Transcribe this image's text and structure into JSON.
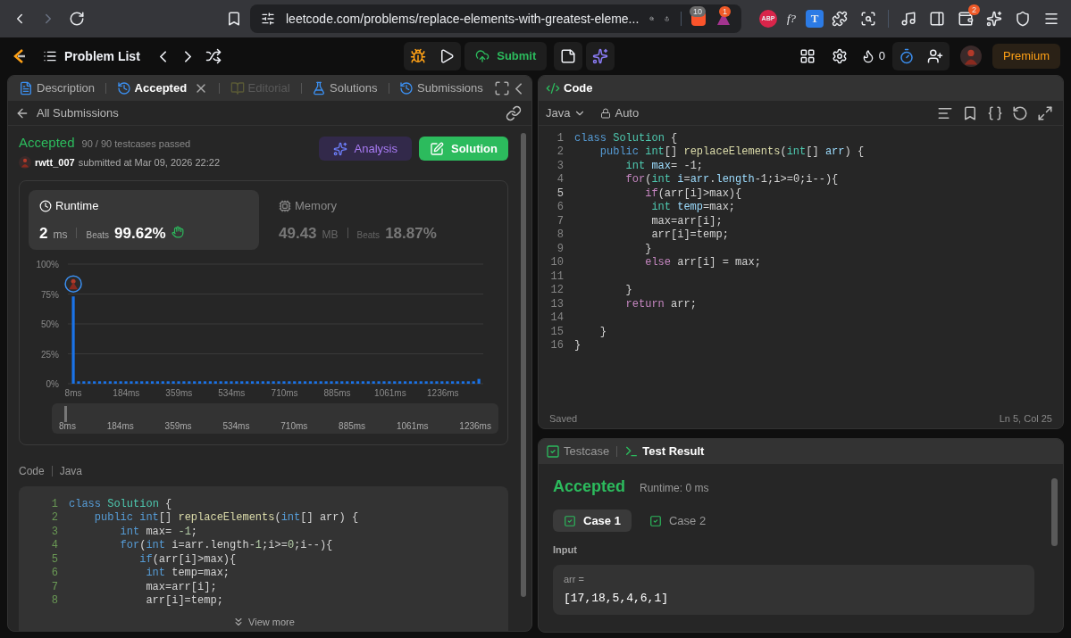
{
  "browser": {
    "url": "leetcode.com/problems/replace-elements-with-greatest-eleme...",
    "brave_badge": "10",
    "alert_badge": "1",
    "abp_label": "ABP",
    "font_label": "f?",
    "t_label": "T",
    "wallet_badge": "2"
  },
  "nav": {
    "problem_list": "Problem List",
    "submit": "Submit",
    "streak": "0",
    "premium": "Premium"
  },
  "left_panel": {
    "tabs": [
      {
        "label": "Description",
        "kind": "doc",
        "selected": false,
        "disabled": false
      },
      {
        "label": "Accepted",
        "kind": "history",
        "selected": true,
        "disabled": false
      },
      {
        "label": "Editorial",
        "kind": "book",
        "selected": false,
        "disabled": true
      },
      {
        "label": "Solutions",
        "kind": "flask",
        "selected": false,
        "disabled": false
      },
      {
        "label": "Submissions",
        "kind": "history",
        "selected": false,
        "disabled": false
      }
    ],
    "back_link": "All Submissions",
    "result": {
      "status": "Accepted",
      "testcases": "90 / 90 testcases passed",
      "user": "rwtt_007",
      "submitted": "submitted at Mar 09, 2026 22:22"
    },
    "analysis_button": "Analysis",
    "solution_button": "Solution",
    "stats": [
      {
        "kind": "runtime",
        "label": "Runtime",
        "value": "2",
        "unit": "ms",
        "beats_label": "Beats",
        "beats": "99.62%",
        "selected": true
      },
      {
        "kind": "memory",
        "label": "Memory",
        "value": "49.43",
        "unit": "MB",
        "beats_label": "Beats",
        "beats": "18.87%",
        "selected": false
      }
    ],
    "chart_data": {
      "type": "bar",
      "grid": true,
      "ylim": [
        0,
        100
      ],
      "xlim": [
        -10,
        1370
      ],
      "yticks": [
        {
          "value": 0,
          "label": "0%"
        },
        {
          "value": 25,
          "label": "25%"
        },
        {
          "value": 50,
          "label": "50%"
        },
        {
          "value": 75,
          "label": "75%"
        },
        {
          "value": 100,
          "label": "100%"
        }
      ],
      "xticks": [
        {
          "value": 8,
          "label": "8ms"
        },
        {
          "value": 184,
          "label": "184ms"
        },
        {
          "value": 359,
          "label": "359ms"
        },
        {
          "value": 534,
          "label": "534ms"
        },
        {
          "value": 710,
          "label": "710ms"
        },
        {
          "value": 885,
          "label": "885ms"
        },
        {
          "value": 1061,
          "label": "1061ms"
        },
        {
          "value": 1236,
          "label": "1236ms"
        }
      ],
      "x": [
        8,
        25.5,
        43,
        60.5,
        78,
        95.5,
        113,
        130.5,
        148,
        165.5,
        183,
        200.5,
        218,
        235.5,
        253,
        270.5,
        288,
        305.5,
        323,
        340.5,
        358,
        375.5,
        393,
        410.5,
        428,
        445.5,
        463,
        480.5,
        498,
        515.5,
        533,
        550.5,
        568,
        585.5,
        603,
        620.5,
        638,
        655.5,
        673,
        690.5,
        708,
        725.5,
        743,
        760.5,
        778,
        795.5,
        813,
        830.5,
        848,
        865.5,
        883,
        900.5,
        918,
        935.5,
        953,
        970.5,
        988,
        1005.5,
        1023,
        1040.5,
        1058,
        1075.5,
        1093,
        1110.5,
        1128,
        1145.5,
        1163,
        1180.5,
        1198,
        1215.5,
        1233,
        1250.5,
        1268,
        1285.5,
        1303,
        1320.5,
        1338,
        1355.5
      ],
      "series": [
        {
          "color": "#1a73e8",
          "values": [
            73,
            2,
            2,
            2,
            2,
            2,
            2,
            2,
            2,
            2,
            2,
            2,
            2,
            2,
            2,
            2,
            2,
            2,
            2,
            2,
            2,
            2,
            2,
            2,
            2,
            2,
            2,
            2,
            2,
            2,
            2,
            2,
            2,
            2,
            2,
            2,
            2,
            2,
            2,
            2,
            2,
            2,
            2,
            2,
            2,
            2,
            2,
            2,
            2,
            2,
            2,
            2,
            2,
            2,
            2,
            2,
            2,
            2,
            2,
            2,
            2,
            2,
            2,
            2,
            2,
            2,
            2,
            2,
            2,
            2,
            2,
            2,
            2,
            2,
            2,
            2,
            2,
            4
          ]
        }
      ]
    },
    "range_labels": [
      "8ms",
      "184ms",
      "359ms",
      "534ms",
      "710ms",
      "885ms",
      "1061ms",
      "1236ms"
    ],
    "code_label": "Code",
    "code_language": "Java",
    "code_lines": [
      {
        "n": "1",
        "tokens": [
          {
            "t": "class ",
            "kind": "kw"
          },
          {
            "t": "Solution",
            "kind": "type"
          },
          {
            "t": " {",
            "kind": "plain"
          }
        ]
      },
      {
        "n": "2",
        "tokens": [
          {
            "t": "    public ",
            "kind": "kw"
          },
          {
            "t": "int",
            "kind": "kw"
          },
          {
            "t": "[] ",
            "kind": "plain"
          },
          {
            "t": "replaceElements",
            "kind": "fn"
          },
          {
            "t": "(",
            "kind": "plain"
          },
          {
            "t": "int",
            "kind": "kw"
          },
          {
            "t": "[] arr) {",
            "kind": "plain"
          }
        ]
      },
      {
        "n": "3",
        "tokens": [
          {
            "t": "        int ",
            "kind": "kw"
          },
          {
            "t": "max= ",
            "kind": "plain"
          },
          {
            "t": "-1",
            "kind": "num"
          },
          {
            "t": ";",
            "kind": "plain"
          }
        ]
      },
      {
        "n": "4",
        "tokens": [
          {
            "t": "        for",
            "kind": "kw"
          },
          {
            "t": "(",
            "kind": "plain"
          },
          {
            "t": "int ",
            "kind": "kw"
          },
          {
            "t": "i=arr.length-",
            "kind": "plain"
          },
          {
            "t": "1",
            "kind": "num"
          },
          {
            "t": ";i>=",
            "kind": "plain"
          },
          {
            "t": "0",
            "kind": "num"
          },
          {
            "t": ";i--){",
            "kind": "plain"
          }
        ]
      },
      {
        "n": "5",
        "tokens": [
          {
            "t": "           if",
            "kind": "kw"
          },
          {
            "t": "(arr[i]>max){",
            "kind": "plain"
          }
        ]
      },
      {
        "n": "6",
        "tokens": [
          {
            "t": "            int ",
            "kind": "kw"
          },
          {
            "t": "temp=max;",
            "kind": "plain"
          }
        ]
      },
      {
        "n": "7",
        "tokens": [
          {
            "t": "            max=arr[i];",
            "kind": "plain"
          }
        ]
      },
      {
        "n": "8",
        "tokens": [
          {
            "t": "            arr[i]=temp;",
            "kind": "plain"
          }
        ]
      }
    ],
    "view_more": "View more"
  },
  "code_panel": {
    "title": "Code",
    "language": "Java",
    "mode": "Auto",
    "status": "Saved",
    "cursor": "Ln 5, Col 25",
    "lines": [
      {
        "n": "1",
        "current": false,
        "tokens": [
          {
            "t": "class ",
            "kind": "kw"
          },
          {
            "t": "Solution",
            "kind": "type"
          },
          {
            "t": " {",
            "kind": "plain"
          }
        ]
      },
      {
        "n": "2",
        "current": false,
        "tokens": [
          {
            "t": "    public ",
            "kind": "kw"
          },
          {
            "t": "int",
            "kind": "type"
          },
          {
            "t": "[] ",
            "kind": "plain"
          },
          {
            "t": "replaceElements",
            "kind": "fn"
          },
          {
            "t": "(",
            "kind": "plain"
          },
          {
            "t": "int",
            "kind": "type"
          },
          {
            "t": "[] ",
            "kind": "plain"
          },
          {
            "t": "arr",
            "kind": "var"
          },
          {
            "t": ") {",
            "kind": "plain"
          }
        ]
      },
      {
        "n": "3",
        "current": false,
        "tokens": [
          {
            "t": "        int ",
            "kind": "type"
          },
          {
            "t": "max",
            "kind": "var"
          },
          {
            "t": "= -1;",
            "kind": "plain"
          }
        ]
      },
      {
        "n": "4",
        "current": false,
        "tokens": [
          {
            "t": "        for",
            "kind": "ctrl"
          },
          {
            "t": "(",
            "kind": "plain"
          },
          {
            "t": "int ",
            "kind": "type"
          },
          {
            "t": "i",
            "kind": "var"
          },
          {
            "t": "=",
            "kind": "plain"
          },
          {
            "t": "arr",
            "kind": "var"
          },
          {
            "t": ".",
            "kind": "plain"
          },
          {
            "t": "length",
            "kind": "var"
          },
          {
            "t": "-1;i>=0;i--){",
            "kind": "plain"
          }
        ]
      },
      {
        "n": "5",
        "current": true,
        "tokens": [
          {
            "t": "           if",
            "kind": "ctrl"
          },
          {
            "t": "(arr[i]>max){",
            "kind": "plain"
          }
        ]
      },
      {
        "n": "6",
        "current": false,
        "tokens": [
          {
            "t": "            int ",
            "kind": "type"
          },
          {
            "t": "temp",
            "kind": "var"
          },
          {
            "t": "=max;",
            "kind": "plain"
          }
        ]
      },
      {
        "n": "7",
        "current": false,
        "tokens": [
          {
            "t": "            max=arr[i];",
            "kind": "plain"
          }
        ]
      },
      {
        "n": "8",
        "current": false,
        "tokens": [
          {
            "t": "            arr[i]=temp;",
            "kind": "plain"
          }
        ]
      },
      {
        "n": "9",
        "current": false,
        "tokens": [
          {
            "t": "           }",
            "kind": "plain"
          }
        ]
      },
      {
        "n": "10",
        "current": false,
        "tokens": [
          {
            "t": "           else ",
            "kind": "ctrl"
          },
          {
            "t": "arr[i] = max;",
            "kind": "plain"
          }
        ]
      },
      {
        "n": "11",
        "current": false
      },
      {
        "n": "12",
        "current": false,
        "tokens": [
          {
            "t": "        }",
            "kind": "plain"
          }
        ]
      },
      {
        "n": "13",
        "current": false,
        "tokens": [
          {
            "t": "        return ",
            "kind": "ctrl"
          },
          {
            "t": "arr;",
            "kind": "plain"
          }
        ]
      },
      {
        "n": "14",
        "current": false
      },
      {
        "n": "15",
        "current": false,
        "tokens": [
          {
            "t": "    }",
            "kind": "plain"
          }
        ]
      },
      {
        "n": "16",
        "current": false,
        "tokens": [
          {
            "t": "}",
            "kind": "plain"
          }
        ]
      }
    ]
  },
  "test_panel": {
    "tabs": [
      {
        "label": "Testcase",
        "kind": "check",
        "selected": false
      },
      {
        "label": "Test Result",
        "kind": "terminal",
        "selected": true
      }
    ],
    "status": "Accepted",
    "runtime": "Runtime: 0 ms",
    "cases": [
      {
        "label": "Case 1",
        "selected": true,
        "passed": true
      },
      {
        "label": "Case 2",
        "selected": false,
        "passed": true
      }
    ],
    "input_label": "Input",
    "params": [
      {
        "name": "arr =",
        "value": "[17,18,5,4,6,1]"
      }
    ]
  }
}
